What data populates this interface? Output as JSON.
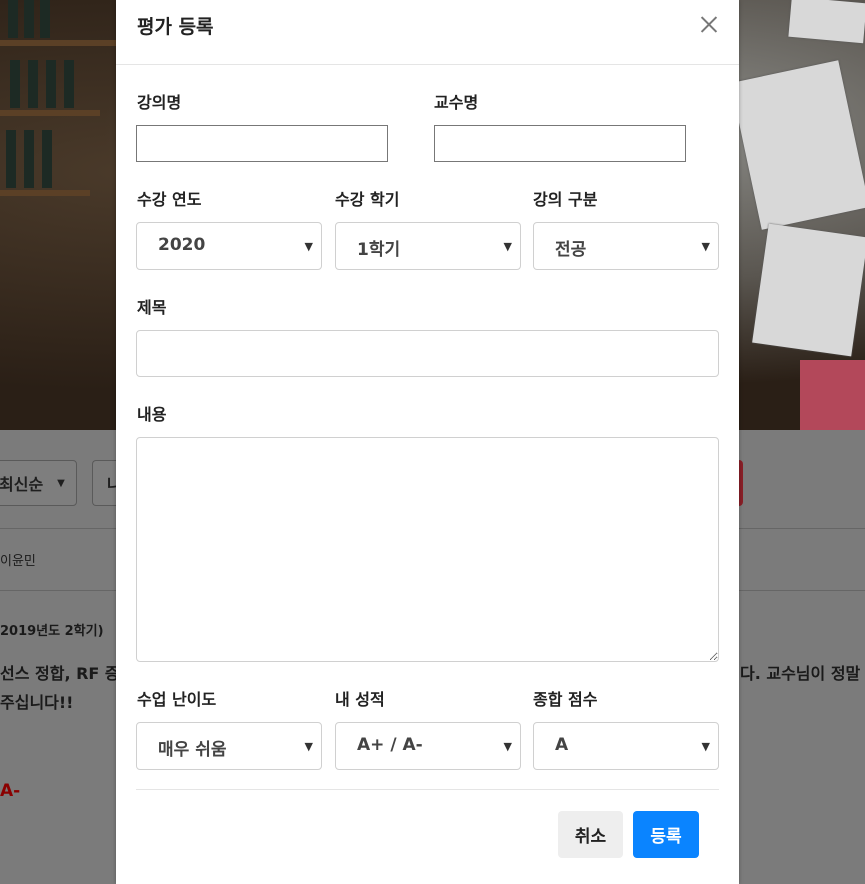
{
  "background": {
    "sort_select": "최신순",
    "second_select": "나",
    "author": "이윤민",
    "semester_line": "2019년도 2학기)",
    "content_line1_left": "선스 정합, RF 증",
    "content_line1_right": "다. 교수님이 정말 친",
    "content_line2": "주십니다!!",
    "grade": "A-"
  },
  "modal": {
    "title": "평가 등록",
    "labels": {
      "lecture_name": "강의명",
      "professor_name": "교수명",
      "year": "수강 연도",
      "semester": "수강 학기",
      "lecture_type": "강의 구분",
      "subject": "제목",
      "content": "내용",
      "difficulty": "수업 난이도",
      "my_grade": "내 성적",
      "total_score": "종합 점수"
    },
    "values": {
      "lecture_name": "",
      "professor_name": "",
      "year": "2020",
      "semester": "1학기",
      "lecture_type": "전공",
      "subject": "",
      "content": "",
      "difficulty": "매우 쉬움",
      "my_grade": "A+ / A-",
      "total_score": "A"
    },
    "buttons": {
      "cancel": "취소",
      "submit": "등록"
    }
  }
}
